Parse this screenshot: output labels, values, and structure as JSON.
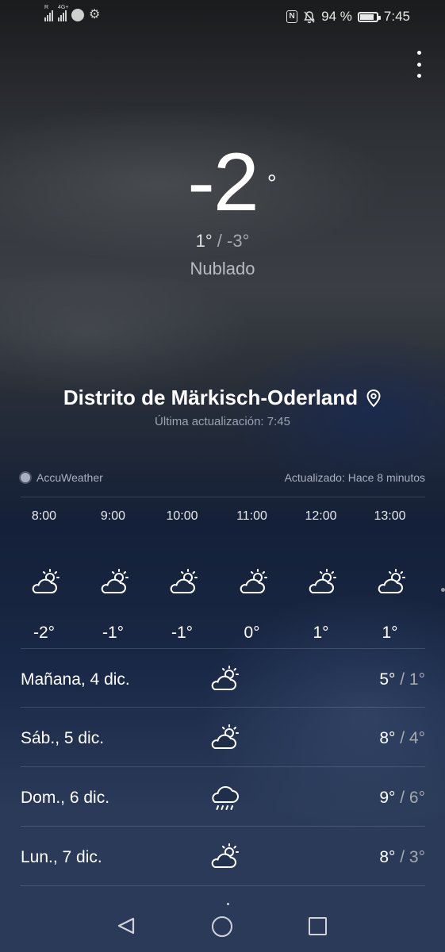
{
  "status_bar": {
    "signal1_tag": "R",
    "signal2_tag": "4G+",
    "battery_text": "94 %",
    "battery_level": 0.94,
    "time": "7:45",
    "icons": [
      "signal-icon",
      "signal-4g-icon",
      "spotify-icon",
      "settings-icon",
      "nfc-icon",
      "mute-icon",
      "battery-icon"
    ]
  },
  "current": {
    "temperature": "-2",
    "degree": "°",
    "high": "1°",
    "sep": "/",
    "low": "-3°",
    "condition": "Nublado"
  },
  "location": {
    "name": "Distrito de Märkisch-Oderland",
    "last_update": "Última actualización: 7:45"
  },
  "provider": {
    "name": "AccuWeather",
    "updated": "Actualizado: Hace 8 minutos"
  },
  "hourly": [
    {
      "time": "8:00",
      "icon": "partly-cloudy-icon",
      "temp": "-2°"
    },
    {
      "time": "9:00",
      "icon": "partly-cloudy-icon",
      "temp": "-1°"
    },
    {
      "time": "10:00",
      "icon": "partly-cloudy-icon",
      "temp": "-1°"
    },
    {
      "time": "11:00",
      "icon": "partly-cloudy-icon",
      "temp": "0°"
    },
    {
      "time": "12:00",
      "icon": "partly-cloudy-icon",
      "temp": "1°"
    },
    {
      "time": "13:00",
      "icon": "partly-cloudy-icon",
      "temp": "1°"
    }
  ],
  "daily": [
    {
      "label": "Mañana, 4 dic.",
      "icon": "partly-cloudy-icon",
      "high": "5°",
      "low": "1°"
    },
    {
      "label": "Sáb., 5 dic.",
      "icon": "partly-cloudy-icon",
      "high": "8°",
      "low": "4°"
    },
    {
      "label": "Dom., 6 dic.",
      "icon": "rain-icon",
      "high": "9°",
      "low": "6°"
    },
    {
      "label": "Lun., 7 dic.",
      "icon": "partly-cloudy-icon",
      "high": "8°",
      "low": "3°"
    }
  ],
  "temp_sep": "/",
  "colors": {
    "text_primary": "#ffffff",
    "text_secondary": "#a6aab0",
    "background_top": "#1a1b1d",
    "background_bottom": "#2a3a58"
  }
}
